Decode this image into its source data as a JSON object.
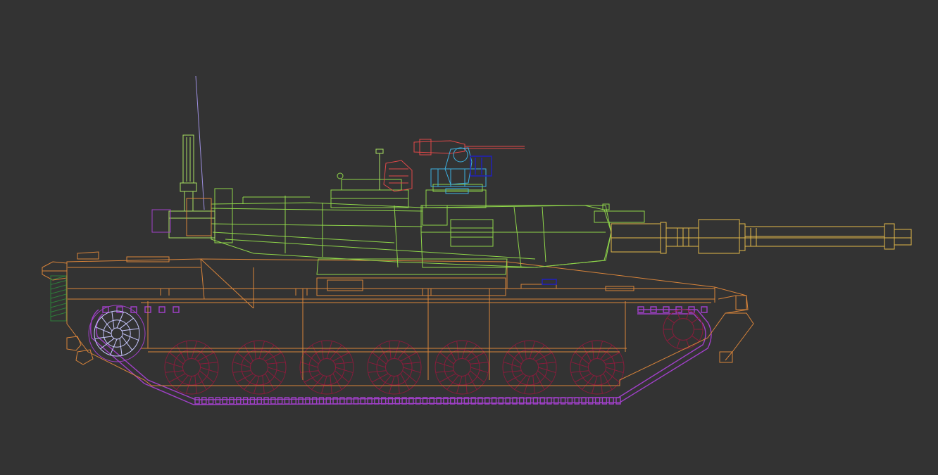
{
  "viewport": {
    "background": "#333333"
  },
  "colors": {
    "hull": "#d9843a",
    "turret": "#8fd64a",
    "gun": "#e3b84a",
    "track": "#a040c8",
    "road_wheels": "#8a1c3c",
    "sprocket": "#c8c8ff",
    "machine_gun": "#e04848",
    "cupola": "#3cb0e0",
    "antenna": "#9d8fe0",
    "mast": "#a8e060",
    "smoke": "#2e7d3a",
    "blue_parts": "#2020c0"
  },
  "model": {
    "icon": "tank-wireframe-icon",
    "road_wheel_count": 7,
    "track_link_count": 62
  }
}
